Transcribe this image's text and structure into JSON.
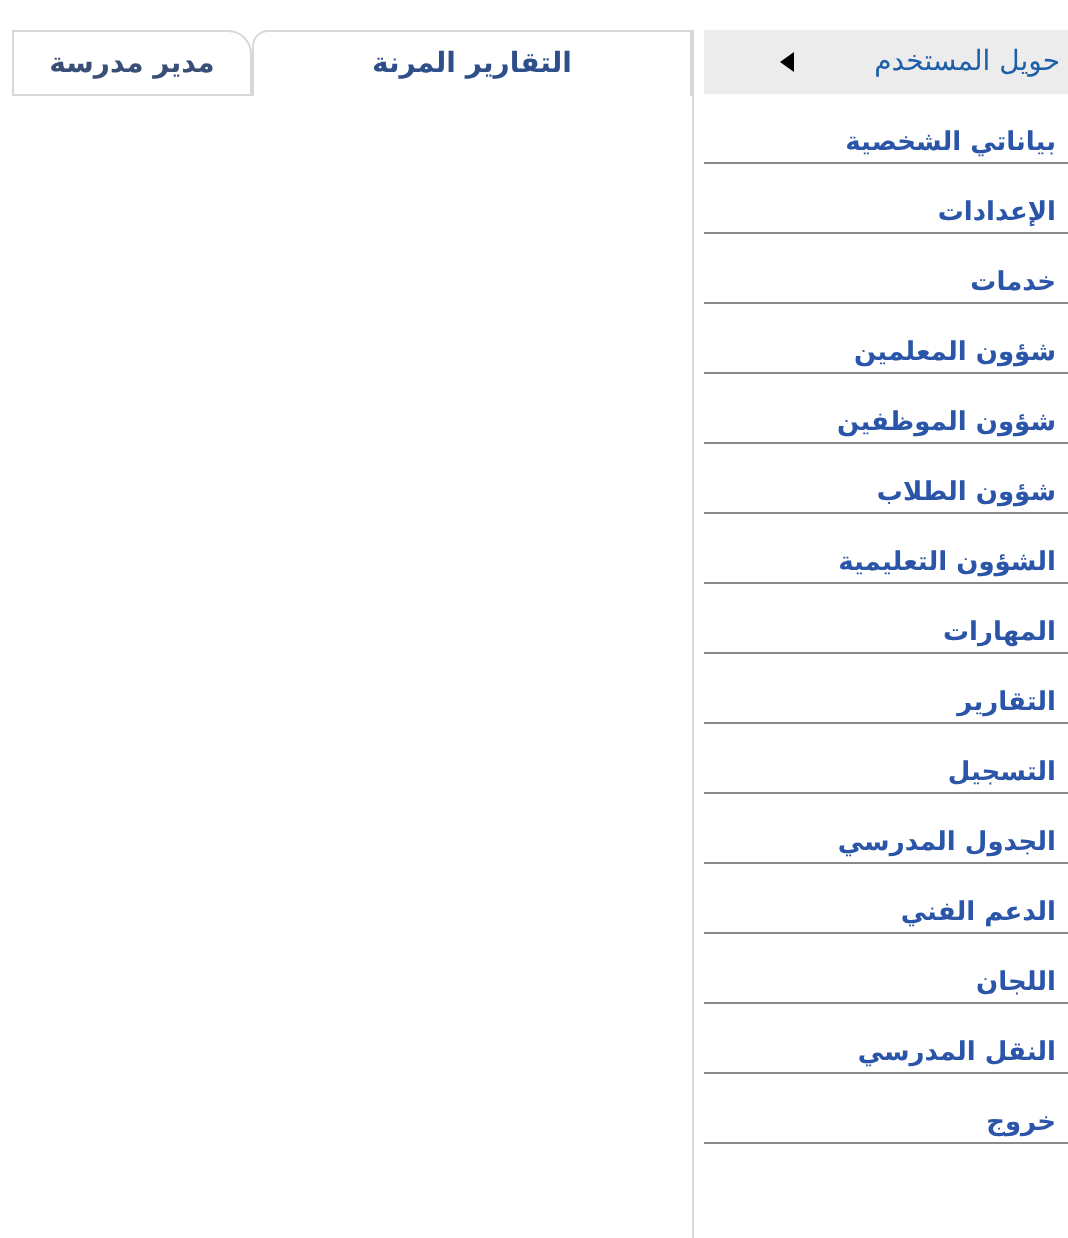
{
  "tabs": [
    {
      "label": "التقارير المرنة",
      "selected": true
    },
    {
      "label": "مدير مدرسة",
      "selected": false
    }
  ],
  "sidebar": {
    "header": "حويل المستخدم",
    "items": [
      "بياناتي الشخصية",
      "الإعدادات",
      "خدمات",
      "شؤون المعلمين",
      "شؤون الموظفين",
      "شؤون الطلاب",
      "الشؤون التعليمية",
      "المهارات",
      "التقارير",
      "التسجيل",
      "الجدول المدرسي",
      "الدعم الفني",
      "اللجان",
      "النقل المدرسي",
      "خروج"
    ]
  }
}
